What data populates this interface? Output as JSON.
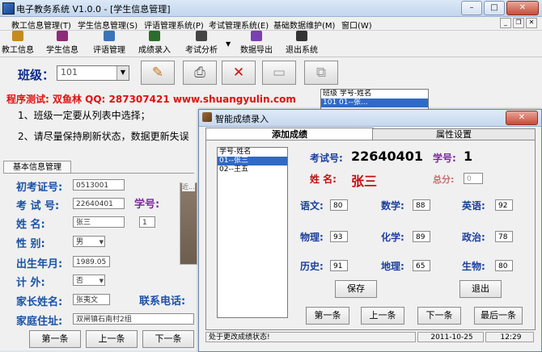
{
  "main_window": {
    "title": "电子教务系统 V1.0.0 - [学生信息管理]",
    "controls": {
      "minimize": "–",
      "maximize": "□",
      "close": "✕"
    },
    "inner_controls": {
      "minimize": "_",
      "restore": "❐",
      "close": "✕"
    }
  },
  "menu": {
    "items": [
      "教工信息管理(T)",
      "学生信息管理(S)",
      "评语管理系统(P)",
      "考试管理系统(E)",
      "基础数据维护(M)",
      "窗口(W)"
    ]
  },
  "toolbar": {
    "items": [
      {
        "label": "教工信息",
        "icon": "teacher-folder-icon",
        "color": "#c58a1c"
      },
      {
        "label": "学生信息",
        "icon": "student-book-icon",
        "color": "#8e2b7a"
      },
      {
        "label": "评语管理",
        "icon": "comment-edit-icon",
        "color": "#3a73b8"
      },
      {
        "label": "成绩录入",
        "icon": "score-entry-icon",
        "color": "#2c6c2c"
      },
      {
        "label": "考试分析",
        "icon": "exam-analysis-icon",
        "color": "#444444"
      },
      {
        "label": "数据导出",
        "icon": "data-export-icon",
        "color": "#7a3fb0"
      },
      {
        "label": "退出系统",
        "icon": "exit-system-icon",
        "color": "#333333"
      }
    ],
    "dropdown_arrow": "▼"
  },
  "class_selector": {
    "label": "班级：",
    "value": "101",
    "arrow": "▼"
  },
  "action_buttons": {
    "edit": "✎",
    "print": "⎙",
    "delete": "✕",
    "save": "▭",
    "copy": "⧉"
  },
  "promo_text": "程序测试: 双鱼林  QQ: 287307421  www.shuangyulin.com",
  "instructions": {
    "line1": "1、班级一定要从列表中选择；",
    "line2": "2、请尽量保持刷新状态，数据更新失误"
  },
  "class_list": {
    "rows": [
      "班级 学号-姓名",
      "101   01--张..."
    ]
  },
  "basic_info": {
    "tab_label": "基本信息管理",
    "fields": {
      "admission_no_label": "初考证号:",
      "admission_no_value": "0513001",
      "exam_no_label": "考 试 号:",
      "exam_no_value": "22640401",
      "student_no_label": "学号:",
      "student_no_value": "1",
      "name_label": "姓    名:",
      "name_value": "张三",
      "gender_label": "性    别:",
      "gender_value": "男",
      "birth_label": "出生年月:",
      "birth_value": "1989.05",
      "outside_label": "计    外:",
      "outside_value": "否",
      "parent_label": "家长姓名:",
      "parent_value": "张夷文",
      "phone_label": "联系电话:",
      "address_label": "家庭住址:",
      "address_value": "双闸镇石南村2组",
      "photo_label": "近..."
    },
    "nav": [
      "第一条",
      "上一条",
      "下一条"
    ]
  },
  "dialog": {
    "title": "智能成绩录入",
    "close": "✕",
    "tabs": {
      "add": "添加成绩",
      "props": "属性设置"
    },
    "student_list": [
      "学号-姓名",
      "01--张三",
      "02--王五"
    ],
    "exam_no_label": "考试号:",
    "exam_no_value": "22640401",
    "student_no_label": "学号:",
    "student_no_value": "1",
    "name_label": "姓  名:",
    "name_value": "张三",
    "total_label": "总分:",
    "total_value": "0",
    "scores": [
      {
        "label": "语文:",
        "value": "80"
      },
      {
        "label": "数学:",
        "value": "88"
      },
      {
        "label": "英语:",
        "value": "92"
      },
      {
        "label": "物理:",
        "value": "93"
      },
      {
        "label": "化学:",
        "value": "89"
      },
      {
        "label": "政治:",
        "value": "78"
      },
      {
        "label": "历史:",
        "value": "91"
      },
      {
        "label": "地理:",
        "value": "65"
      },
      {
        "label": "生物:",
        "value": "80"
      }
    ],
    "save_button": "保存",
    "exit_button": "退出",
    "nav": [
      "第一条",
      "上一条",
      "下一条",
      "最后一条"
    ],
    "status": {
      "message": "处于更改成绩状态!",
      "date": "2011-10-25",
      "time": "12:29"
    },
    "colors": {
      "exam_no": "#000000",
      "name": "#c01010",
      "label": "#1b3f9c"
    }
  }
}
